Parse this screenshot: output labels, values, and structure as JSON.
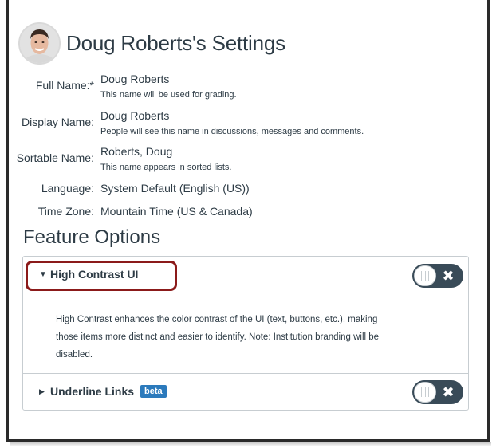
{
  "header": {
    "title": "Doug Roberts's Settings",
    "avatar_alt": "Doug Roberts"
  },
  "profile": {
    "full_name": {
      "label": "Full Name:*",
      "value": "Doug Roberts",
      "hint": "This name will be used for grading."
    },
    "display_name": {
      "label": "Display Name:",
      "value": "Doug Roberts",
      "hint": "People will see this name in discussions, messages and comments."
    },
    "sortable_name": {
      "label": "Sortable Name:",
      "value": "Roberts, Doug",
      "hint": "This name appears in sorted lists."
    },
    "language": {
      "label": "Language:",
      "value": "System Default (English (US))"
    },
    "time_zone": {
      "label": "Time Zone:",
      "value": "Mountain Time (US & Canada)"
    }
  },
  "feature_options": {
    "title": "Feature Options",
    "items": [
      {
        "name": "High Contrast UI",
        "expanded": true,
        "enabled": false,
        "description": "High Contrast enhances the color contrast of the UI (text, buttons, etc.), making those items more distinct and easier to identify. Note: Institution branding will be disabled."
      },
      {
        "name": "Underline Links",
        "expanded": false,
        "enabled": false,
        "badge": "beta"
      }
    ]
  },
  "icons": {
    "expanded_caret": "▼",
    "collapsed_caret": "▶",
    "toggle_off": "✖"
  },
  "colors": {
    "text": "#2d3b45",
    "toggle_bg": "#394b58",
    "badge_bg": "#2b7abc",
    "highlight": "#8b1a1a",
    "border": "#c7cdd1"
  }
}
